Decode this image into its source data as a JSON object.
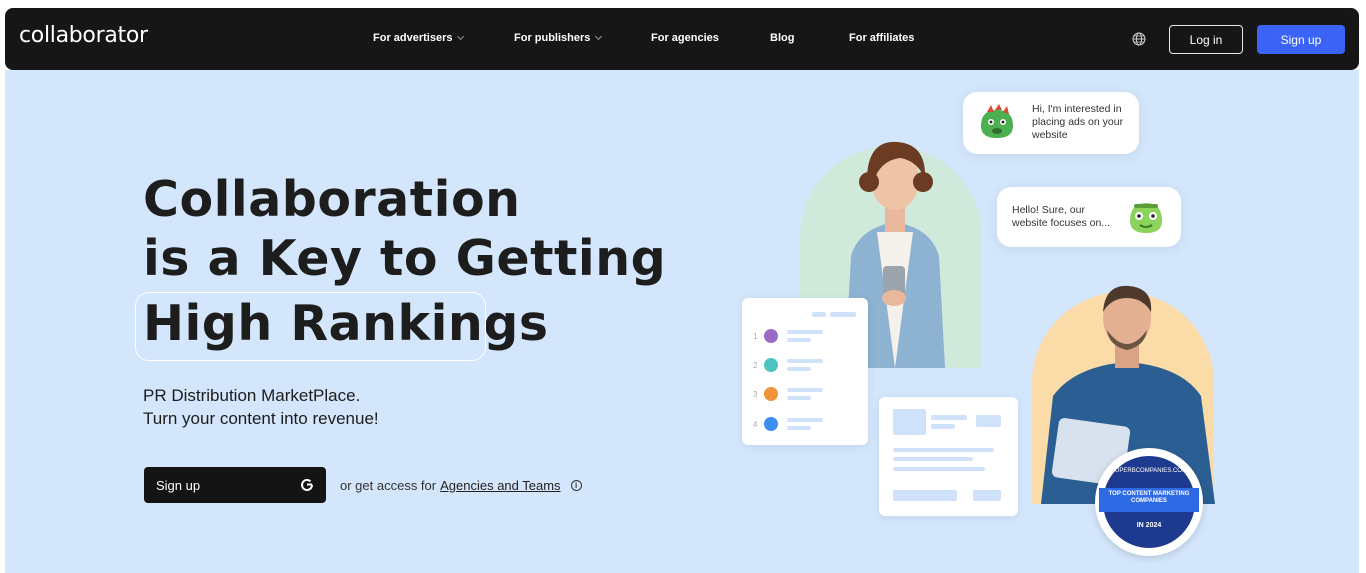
{
  "nav": {
    "logo": "collaborator",
    "items": [
      {
        "label": "For advertisers",
        "dropdown": true
      },
      {
        "label": "For publishers",
        "dropdown": true
      },
      {
        "label": "For agencies",
        "dropdown": false
      },
      {
        "label": "Blog",
        "dropdown": false
      },
      {
        "label": "For affiliates",
        "dropdown": false
      }
    ],
    "language_icon": "globe-icon",
    "login_label": "Log in",
    "signup_label": "Sign up"
  },
  "hero": {
    "headline": [
      "Collaboration",
      "is a Key to Getting",
      "High Rankings"
    ],
    "subtitle": [
      "PR Distribution MarketPlace.",
      "Turn your content into revenue!"
    ],
    "cta_label": "Sign up",
    "cta_icon": "google-icon",
    "access_prefix": "or get access for",
    "access_link": "Agencies and Teams",
    "info_icon": "info-icon"
  },
  "illustration": {
    "chat": [
      {
        "text": "Hi, I'm interested in placing ads on your website"
      },
      {
        "text": "Hello! Sure, our website focuses on..."
      }
    ],
    "list_numbers": [
      "1",
      "2",
      "3",
      "4"
    ],
    "list_dot_colors": [
      "#9b6cc7",
      "#4cc3c0",
      "#f0943a",
      "#3d8df0"
    ],
    "badge": {
      "top": "SUPERBCOMPANIES.COM",
      "title": "TOP CONTENT MARKETING COMPANIES",
      "year": "IN 2024"
    }
  },
  "colors": {
    "nav_bg": "#161616",
    "hero_bg": "#d3e6fb",
    "accent": "#3b64f6"
  }
}
